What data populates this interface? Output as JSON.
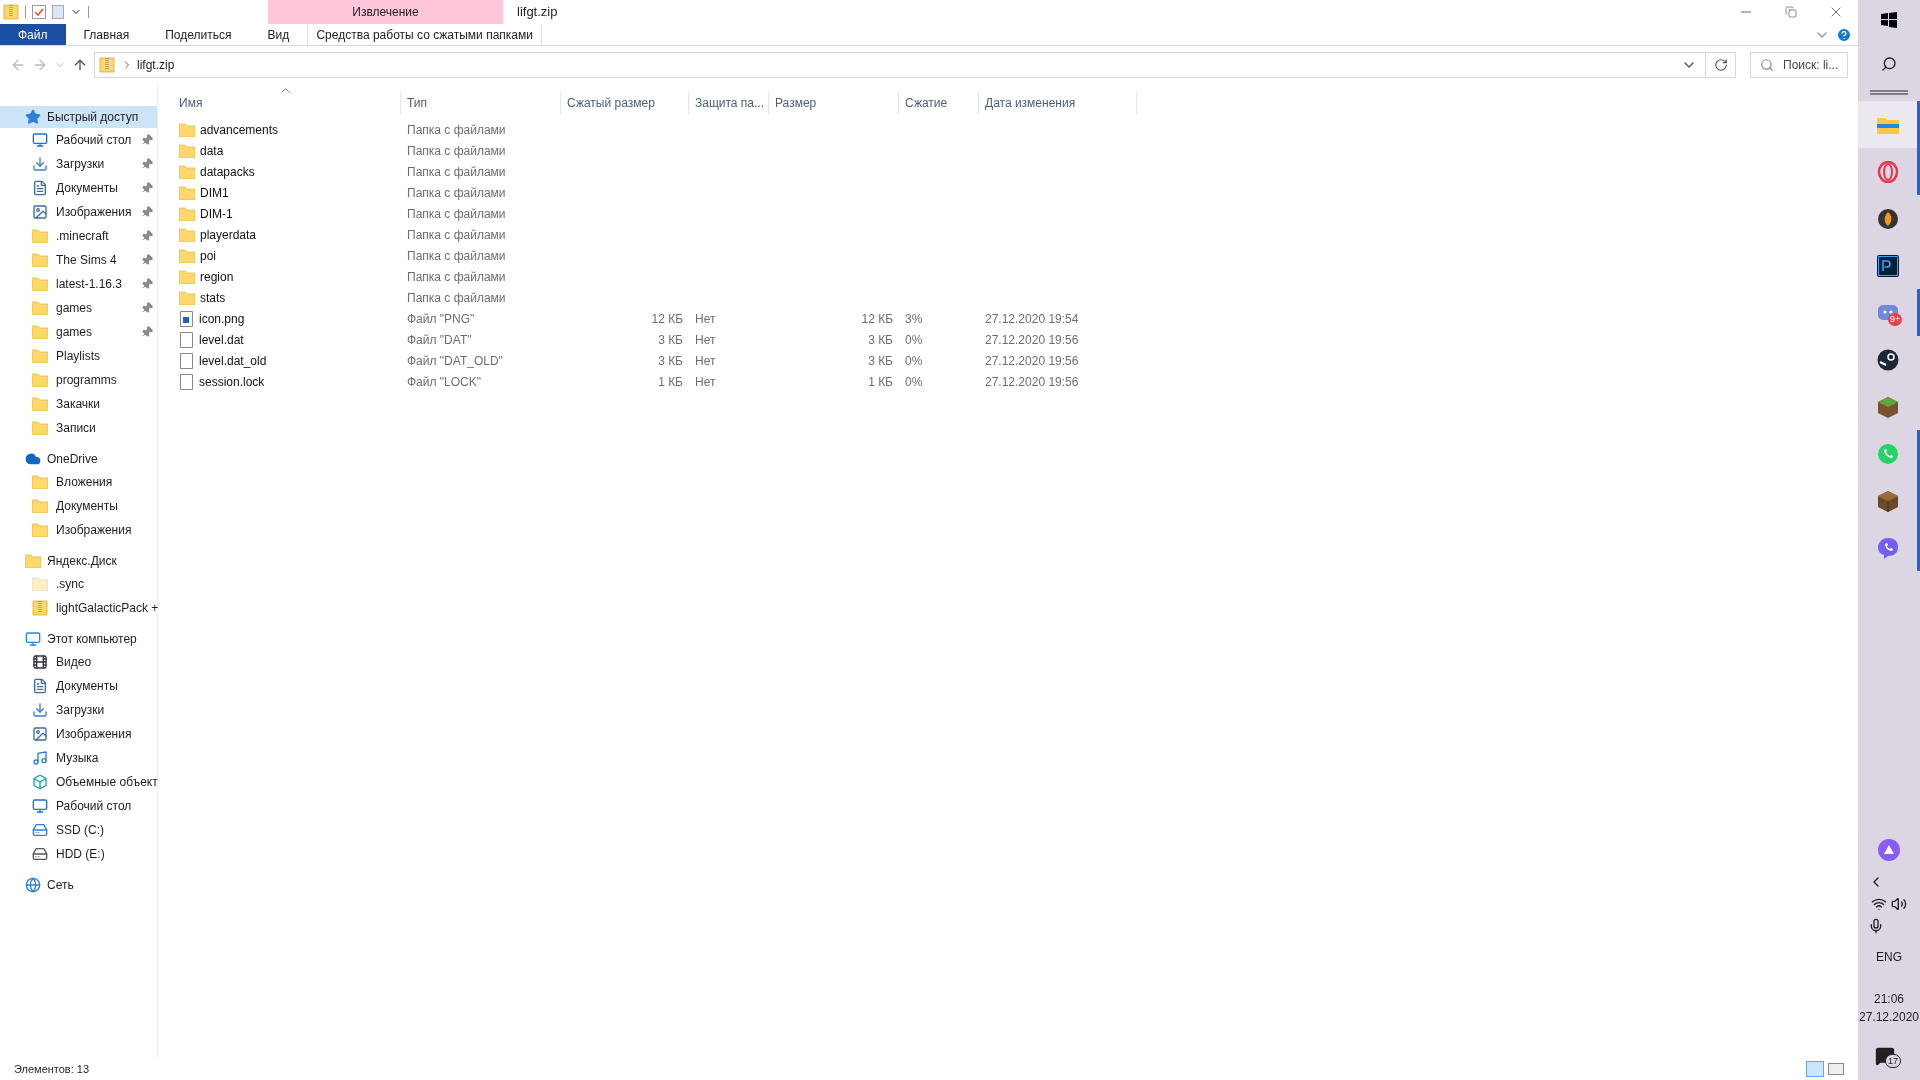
{
  "window": {
    "title": "lifgt.zip",
    "contextual_group": "Извлечение"
  },
  "ribbon_tabs": [
    {
      "label": "Файл",
      "selected": true
    },
    {
      "label": "Главная",
      "selected": false
    },
    {
      "label": "Поделиться",
      "selected": false
    },
    {
      "label": "Вид",
      "selected": false
    },
    {
      "label": "Средства работы со сжатыми папками",
      "selected": false
    }
  ],
  "address_bar": {
    "path": "lifgt.zip",
    "search_placeholder": "Поиск: li..."
  },
  "sidebar": {
    "groups": [
      {
        "label": "Быстрый доступ",
        "kind": "star",
        "selected": true,
        "children": [
          {
            "label": "Рабочий стол",
            "kind": "desktop",
            "pinned": true
          },
          {
            "label": "Загрузки",
            "kind": "download",
            "pinned": true
          },
          {
            "label": "Документы",
            "kind": "document",
            "pinned": true
          },
          {
            "label": "Изображения",
            "kind": "pictures",
            "pinned": true
          },
          {
            "label": ".minecraft",
            "kind": "folder",
            "pinned": true
          },
          {
            "label": "The Sims 4",
            "kind": "folder",
            "pinned": true
          },
          {
            "label": "latest-1.16.3",
            "kind": "folder",
            "pinned": true
          },
          {
            "label": "games",
            "kind": "folder",
            "pinned": true
          },
          {
            "label": "games",
            "kind": "folder",
            "pinned": true
          },
          {
            "label": "Playlists",
            "kind": "folder",
            "pinned": false
          },
          {
            "label": "programms",
            "kind": "folder",
            "pinned": false
          },
          {
            "label": "Закачки",
            "kind": "folder",
            "pinned": false
          },
          {
            "label": "Записи",
            "kind": "folder",
            "pinned": false
          }
        ]
      },
      {
        "label": "OneDrive",
        "kind": "cloud",
        "selected": false,
        "children": [
          {
            "label": "Вложения",
            "kind": "folder"
          },
          {
            "label": "Документы",
            "kind": "folder"
          },
          {
            "label": "Изображения",
            "kind": "folder"
          }
        ]
      },
      {
        "label": "Яндекс.Диск",
        "kind": "folder",
        "selected": false,
        "children": [
          {
            "label": ".sync",
            "kind": "hidden-folder"
          },
          {
            "label": "lightGalacticPack +",
            "kind": "zip"
          }
        ]
      },
      {
        "label": "Этот компьютер",
        "kind": "computer",
        "selected": false,
        "children": [
          {
            "label": "Видео",
            "kind": "video"
          },
          {
            "label": "Документы",
            "kind": "document"
          },
          {
            "label": "Загрузки",
            "kind": "download"
          },
          {
            "label": "Изображения",
            "kind": "pictures"
          },
          {
            "label": "Музыка",
            "kind": "music"
          },
          {
            "label": "Объемные объект",
            "kind": "cube"
          },
          {
            "label": "Рабочий стол",
            "kind": "desktop"
          },
          {
            "label": "SSD (C:)",
            "kind": "ssd"
          },
          {
            "label": "HDD (E:)",
            "kind": "drive"
          }
        ]
      },
      {
        "label": "Сеть",
        "kind": "network",
        "selected": false
      }
    ]
  },
  "table": {
    "columns": [
      "Имя",
      "Тип",
      "Сжатый размер",
      "Защита па...",
      "Размер",
      "Сжатие",
      "Дата изменения"
    ],
    "rows": [
      {
        "kind": "folder",
        "cells": [
          "advancements",
          "Папка с файлами"
        ]
      },
      {
        "kind": "folder",
        "cells": [
          "data",
          "Папка с файлами"
        ]
      },
      {
        "kind": "folder",
        "cells": [
          "datapacks",
          "Папка с файлами"
        ]
      },
      {
        "kind": "folder",
        "cells": [
          "DIM1",
          "Папка с файлами"
        ]
      },
      {
        "kind": "folder",
        "cells": [
          "DIM-1",
          "Папка с файлами"
        ]
      },
      {
        "kind": "folder",
        "cells": [
          "playerdata",
          "Папка с файлами"
        ]
      },
      {
        "kind": "folder",
        "cells": [
          "poi",
          "Папка с файлами"
        ]
      },
      {
        "kind": "folder",
        "cells": [
          "region",
          "Папка с файлами"
        ]
      },
      {
        "kind": "folder",
        "cells": [
          "stats",
          "Папка с файлами"
        ]
      },
      {
        "kind": "image",
        "cells": [
          "icon.png",
          "Файл \"PNG\"",
          "12 КБ",
          "Нет",
          "12 КБ",
          "3%",
          "27.12.2020 19:54"
        ]
      },
      {
        "kind": "file",
        "cells": [
          "level.dat",
          "Файл \"DAT\"",
          "3 КБ",
          "Нет",
          "3 КБ",
          "0%",
          "27.12.2020 19:56"
        ]
      },
      {
        "kind": "file",
        "cells": [
          "level.dat_old",
          "Файл \"DAT_OLD\"",
          "3 КБ",
          "Нет",
          "3 КБ",
          "0%",
          "27.12.2020 19:56"
        ]
      },
      {
        "kind": "file",
        "cells": [
          "session.lock",
          "Файл \"LOCK\"",
          "1 КБ",
          "Нет",
          "1 КБ",
          "0%",
          "27.12.2020 19:56"
        ]
      }
    ]
  },
  "status_bar": {
    "item_count": "Элементов: 13"
  },
  "taskbar": {
    "apps": [
      {
        "kind": "explorer",
        "selected": true,
        "running": true
      },
      {
        "kind": "opera",
        "selected": false,
        "running": true
      },
      {
        "kind": "fl",
        "selected": false,
        "running": false
      },
      {
        "kind": "ps",
        "selected": false,
        "running": false
      },
      {
        "kind": "discord",
        "selected": false,
        "running": true,
        "badge": "9+"
      },
      {
        "kind": "steam",
        "selected": false,
        "running": false
      },
      {
        "kind": "grass",
        "selected": false,
        "running": false
      },
      {
        "kind": "whatsapp",
        "selected": false,
        "running": true
      },
      {
        "kind": "crafting",
        "selected": false,
        "running": true
      },
      {
        "kind": "viber",
        "selected": false,
        "running": true
      }
    ],
    "language": "ENG",
    "time": "21:06",
    "date": "27.12.2020",
    "notification_count": "17"
  }
}
